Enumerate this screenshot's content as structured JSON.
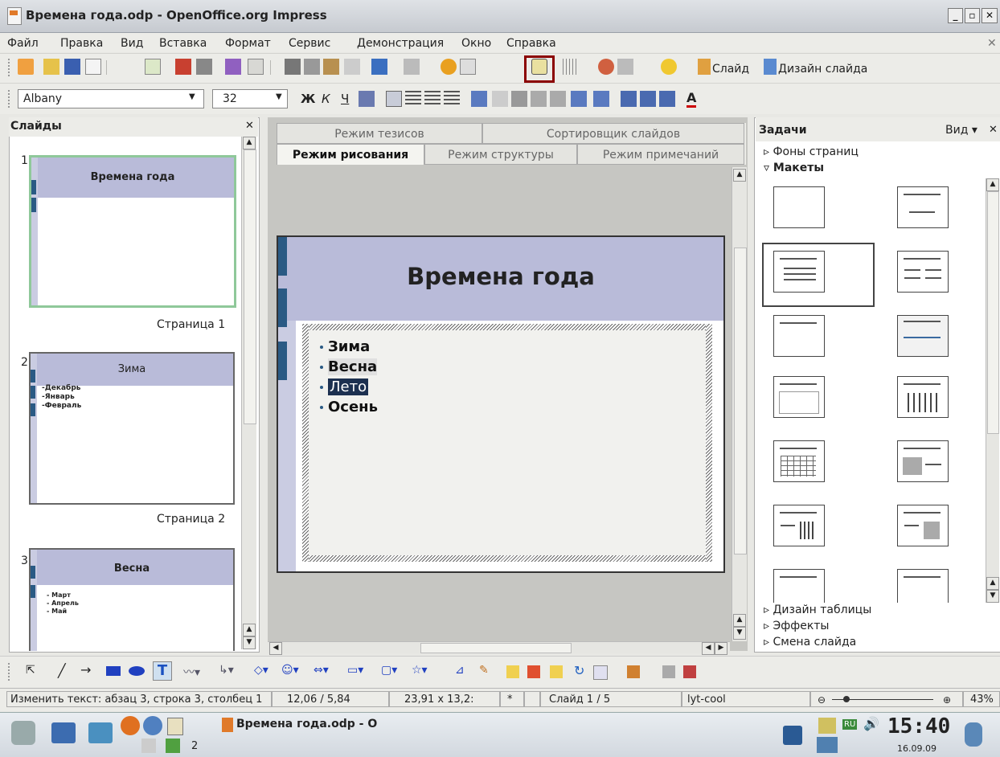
{
  "window": {
    "title": "Времена года.odp - OpenOffice.org Impress"
  },
  "menu": [
    "Файл",
    "Правка",
    "Вид",
    "Вставка",
    "Формат",
    "Сервис",
    "Демонстрация",
    "Окно",
    "Справка"
  ],
  "toolbar": {
    "slide_label": "Слайд",
    "design_label": "Дизайн слайда"
  },
  "format": {
    "font": "Albany",
    "size": "32"
  },
  "slides_panel": {
    "title": "Слайды",
    "slides": [
      {
        "num": "1",
        "title": "Времена года",
        "page": "Страница 1",
        "bullets": []
      },
      {
        "num": "2",
        "title": "Зима",
        "page": "Страница 2",
        "bullets": [
          "Декабрь",
          "Январь",
          "Февраль"
        ]
      },
      {
        "num": "3",
        "title": "Весна",
        "page": "",
        "bullets": [
          "Март",
          "Апрель",
          "Май"
        ]
      }
    ]
  },
  "tabs": {
    "top": [
      "Режим тезисов",
      "Сортировщик слайдов"
    ],
    "bottom": [
      "Режим рисования",
      "Режим структуры",
      "Режим примечаний"
    ]
  },
  "slide": {
    "title": "Времена года",
    "bullets": [
      "Зима",
      "Весна",
      "Лето",
      "Осень"
    ],
    "selected": "Лето"
  },
  "tasks": {
    "title": "Задачи",
    "view": "Вид",
    "sections_top": [
      "Фоны страниц",
      "Макеты"
    ],
    "sections_bottom": [
      "Дизайн таблицы",
      "Эффекты",
      "Смена слайда"
    ]
  },
  "status": {
    "edit": "Изменить текст: абзац 3, строка 3, столбец 1",
    "pos": "12,06 / 5,84",
    "size": "23,91 x 13,2:",
    "mod": "*",
    "slide": "Слайд 1 / 5",
    "layout": "lyt-cool",
    "zoom": "43%"
  },
  "taskbar": {
    "task": "Времена года.odp - O",
    "workspace": "2",
    "lang": "RU",
    "time": "15:40",
    "date": "16.09.09"
  },
  "colors": {
    "accent_band": "#b9bbd9",
    "marker": "#2a5a84",
    "highlight_box": "#8b0000"
  }
}
